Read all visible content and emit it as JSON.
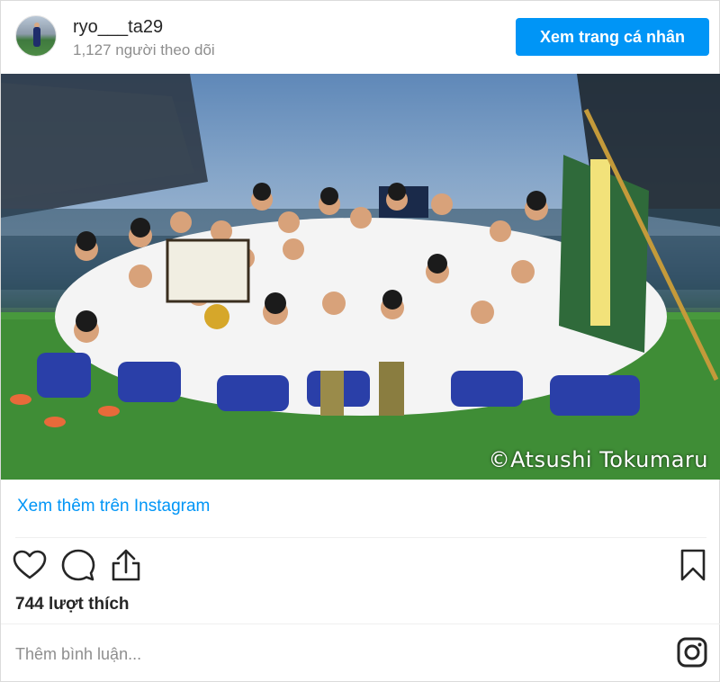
{
  "post": {
    "username": "ryo___ta29",
    "followers": "1,127 người theo dõi",
    "profile_button": "Xem trang cá nhân",
    "photo_credit": "©Atsushi Tokumaru",
    "more_link": "Xem thêm trên Instagram",
    "likes": "744 lượt thích",
    "comment_placeholder": "Thêm bình luận..."
  },
  "colors": {
    "accent": "#0095f6",
    "text": "#262626",
    "muted": "#8e8e8e",
    "divider": "#efefef"
  },
  "icons": [
    "heart-icon",
    "comment-icon",
    "share-icon",
    "bookmark-icon",
    "instagram-icon"
  ]
}
